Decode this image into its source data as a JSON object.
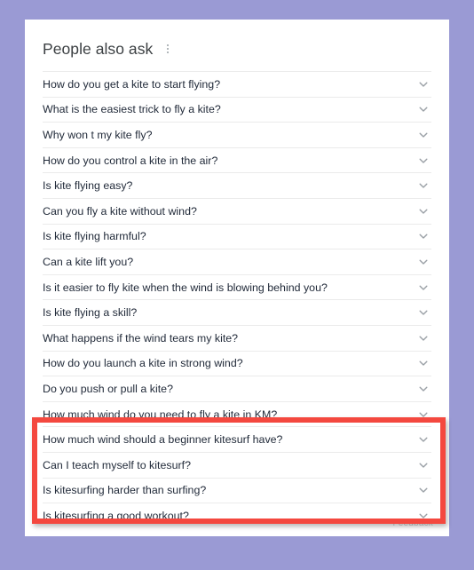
{
  "page": {
    "background_color": "#9a9ad4",
    "card_background": "#ffffff"
  },
  "header": {
    "title": "People also ask",
    "menu_icon": "kebab-menu-icon"
  },
  "questions": [
    {
      "text": "How do you get a kite to start flying?",
      "expand_icon": "chevron-down-icon",
      "highlighted": false
    },
    {
      "text": "What is the easiest trick to fly a kite?",
      "expand_icon": "chevron-down-icon",
      "highlighted": false
    },
    {
      "text": "Why won t my kite fly?",
      "expand_icon": "chevron-down-icon",
      "highlighted": false
    },
    {
      "text": "How do you control a kite in the air?",
      "expand_icon": "chevron-down-icon",
      "highlighted": false
    },
    {
      "text": "Is kite flying easy?",
      "expand_icon": "chevron-down-icon",
      "highlighted": false
    },
    {
      "text": "Can you fly a kite without wind?",
      "expand_icon": "chevron-down-icon",
      "highlighted": false
    },
    {
      "text": "Is kite flying harmful?",
      "expand_icon": "chevron-down-icon",
      "highlighted": false
    },
    {
      "text": "Can a kite lift you?",
      "expand_icon": "chevron-down-icon",
      "highlighted": false
    },
    {
      "text": "Is it easier to fly kite when the wind is blowing behind you?",
      "expand_icon": "chevron-down-icon",
      "highlighted": false
    },
    {
      "text": "Is kite flying a skill?",
      "expand_icon": "chevron-down-icon",
      "highlighted": false
    },
    {
      "text": "What happens if the wind tears my kite?",
      "expand_icon": "chevron-down-icon",
      "highlighted": false
    },
    {
      "text": "How do you launch a kite in strong wind?",
      "expand_icon": "chevron-down-icon",
      "highlighted": false
    },
    {
      "text": "Do you push or pull a kite?",
      "expand_icon": "chevron-down-icon",
      "highlighted": false
    },
    {
      "text": "How much wind do you need to fly a kite in KM?",
      "expand_icon": "chevron-down-icon",
      "highlighted": false
    },
    {
      "text": "How much wind should a beginner kitesurf have?",
      "expand_icon": "chevron-down-icon",
      "highlighted": true
    },
    {
      "text": "Can I teach myself to kitesurf?",
      "expand_icon": "chevron-down-icon",
      "highlighted": true
    },
    {
      "text": "Is kitesurfing harder than surfing?",
      "expand_icon": "chevron-down-icon",
      "highlighted": true
    },
    {
      "text": "Is kitesurfing a good workout?",
      "expand_icon": "chevron-down-icon",
      "highlighted": true
    }
  ],
  "footer": {
    "feedback_label": "Feedback"
  },
  "annotation": {
    "type": "highlight-box",
    "color": "#f4483f",
    "covers_questions": [
      "How much wind should a beginner kitesurf have?",
      "Can I teach myself to kitesurf?",
      "Is kitesurfing harder than surfing?",
      "Is kitesurfing a good workout?"
    ]
  }
}
